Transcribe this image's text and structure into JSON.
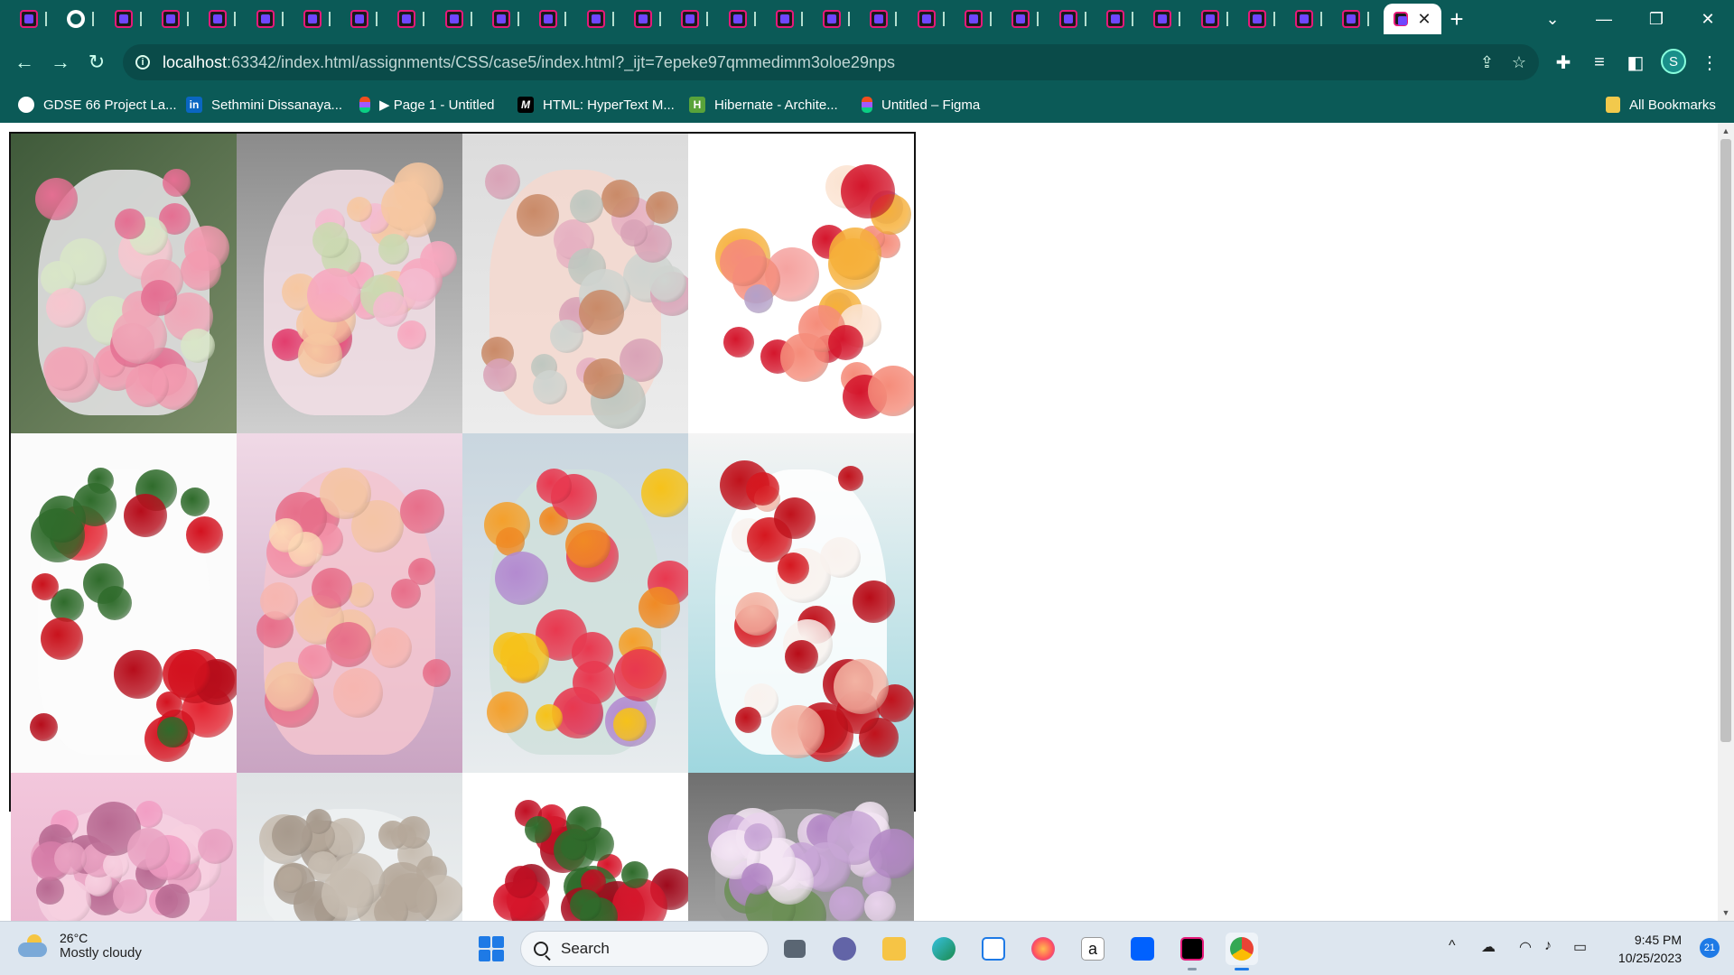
{
  "browser": {
    "active_tab_close": "✕",
    "new_tab": "+",
    "tab_search": "⌄",
    "window": {
      "minimize": "—",
      "restore": "❐",
      "close": "✕"
    },
    "nav": {
      "back": "←",
      "forward": "→",
      "reload": "↻"
    },
    "url_host": "localhost",
    "url_rest": ":63342/index.html/assignments/CSS/case5/index.html?_ijt=7epeke97qmmedimm3oloe29nps",
    "profile_initial": "S"
  },
  "bookmarks": [
    {
      "label": "GDSE 66 Project La...",
      "icon": "github-icon"
    },
    {
      "label": "Sethmini Dissanaya...",
      "icon": "linkedin-icon",
      "mark": "in"
    },
    {
      "label": "▶ Page 1 - Untitled",
      "icon": "figma-icon"
    },
    {
      "label": "HTML: HyperText M...",
      "icon": "mdn-icon",
      "mark": "M"
    },
    {
      "label": "Hibernate - Archite...",
      "icon": "hibernate-icon",
      "mark": "H"
    },
    {
      "label": "Untitled – Figma",
      "icon": "figma-icon"
    }
  ],
  "all_bookmarks": "All Bookmarks",
  "gallery": {
    "photos": [
      {
        "subject": "pink roses bouquet in white paper"
      },
      {
        "subject": "pink and peach bouquet held in hands"
      },
      {
        "subject": "dried flower bouquet in pink paper"
      },
      {
        "subject": "mixed color roses bouquet"
      },
      {
        "subject": "red roses bunch"
      },
      {
        "subject": "pink peony and rose bouquet"
      },
      {
        "subject": "sunflower and lily vase"
      },
      {
        "subject": "red roses and carnations in white wrap"
      },
      {
        "subject": "pink gerbera daisies"
      },
      {
        "subject": "dried flowers on grey"
      },
      {
        "subject": "red roses in glass vase"
      },
      {
        "subject": "lilac flowers on grey"
      }
    ]
  },
  "taskbar": {
    "weather_temp": "26°C",
    "weather_desc": "Mostly cloudy",
    "search_label": "Search",
    "time": "9:45 PM",
    "date": "10/25/2023",
    "notifications": "21",
    "tray_chevron": "^"
  }
}
